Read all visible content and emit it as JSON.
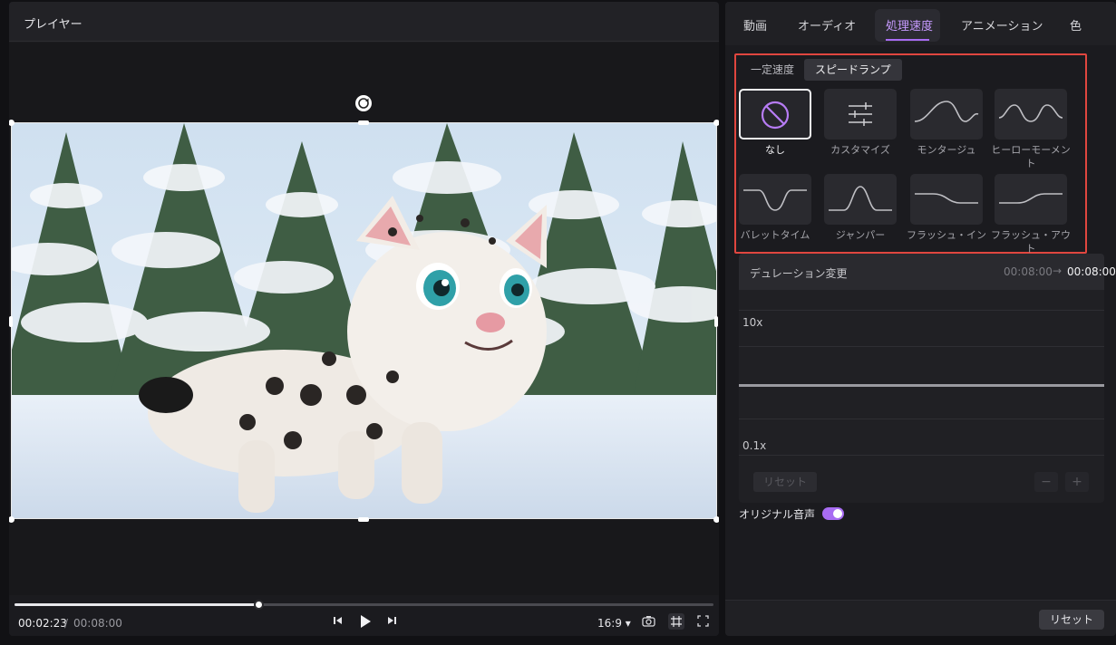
{
  "player": {
    "title": "プレイヤー",
    "time_current": "00:02:23",
    "time_separator": "/",
    "time_total": "00:08:00",
    "progress": 0.35,
    "aspect_ratio": "16:9 ▾"
  },
  "inspector": {
    "tabs": [
      {
        "label": "動画",
        "active": false
      },
      {
        "label": "オーディオ",
        "active": false
      },
      {
        "label": "処理速度",
        "active": true
      },
      {
        "label": "アニメーション",
        "active": false
      },
      {
        "label": "色",
        "active": false
      }
    ],
    "subtabs": {
      "constant": "一定速度",
      "ramp": "スピードランプ"
    },
    "presets": [
      {
        "label": "なし",
        "icon": "none-circle-icon",
        "selected": true
      },
      {
        "label": "カスタマイズ",
        "icon": "sliders-icon",
        "selected": false
      },
      {
        "label": "モンタージュ",
        "icon": "montage-curve-icon",
        "selected": false
      },
      {
        "label": "ヒーローモーメント",
        "icon": "hero-curve-icon",
        "selected": false
      },
      {
        "label": "バレットタイム",
        "icon": "bullet-curve-icon",
        "selected": false
      },
      {
        "label": "ジャンパー",
        "icon": "jumper-curve-icon",
        "selected": false
      },
      {
        "label": "フラッシュ・イン",
        "icon": "flash-in-curve-icon",
        "selected": false
      },
      {
        "label": "フラッシュ・アウト",
        "icon": "flash-out-curve-icon",
        "selected": false
      }
    ],
    "duration": {
      "label": "デュレーション変更",
      "old": "00:08:00",
      "arrow": "→",
      "new": "00:08:00"
    },
    "graph": {
      "y_max": "10x",
      "y_min": "0.1x",
      "reset": "リセット",
      "minus": "−",
      "plus": "+"
    },
    "original_audio": {
      "label": "オリジナル音声",
      "enabled": true
    },
    "footer_reset": "リセット"
  },
  "colors": {
    "accent": "#a86cf2",
    "highlight_border": "#e0463f"
  }
}
